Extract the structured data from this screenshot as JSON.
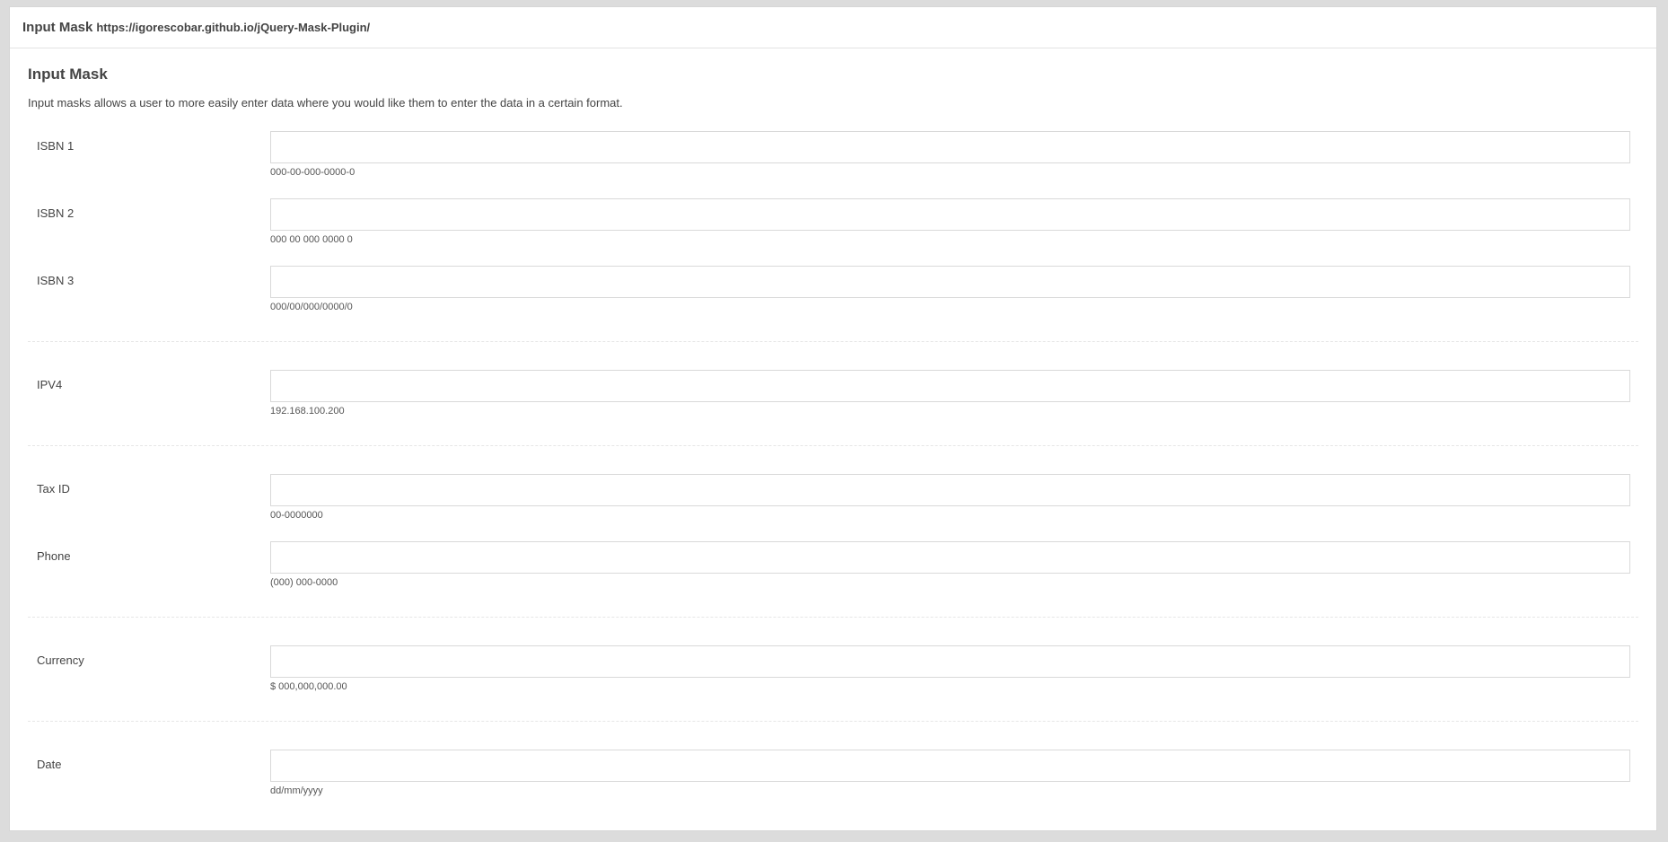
{
  "header": {
    "title": "Input Mask",
    "url": "https://igorescobar.github.io/jQuery-Mask-Plugin/"
  },
  "section": {
    "title": "Input Mask",
    "description": "Input masks allows a user to more easily enter data where you would like them to enter the data in a certain format."
  },
  "fields": {
    "isbn1": {
      "label": "ISBN 1",
      "value": "",
      "help": "000-00-000-0000-0"
    },
    "isbn2": {
      "label": "ISBN 2",
      "value": "",
      "help": "000 00 000 0000 0"
    },
    "isbn3": {
      "label": "ISBN 3",
      "value": "",
      "help": "000/00/000/0000/0"
    },
    "ipv4": {
      "label": "IPV4",
      "value": "",
      "help": "192.168.100.200"
    },
    "taxid": {
      "label": "Tax ID",
      "value": "",
      "help": "00-0000000"
    },
    "phone": {
      "label": "Phone",
      "value": "",
      "help": "(000) 000-0000"
    },
    "currency": {
      "label": "Currency",
      "value": "",
      "help": "$ 000,000,000.00"
    },
    "date": {
      "label": "Date",
      "value": "",
      "help": "dd/mm/yyyy"
    }
  }
}
